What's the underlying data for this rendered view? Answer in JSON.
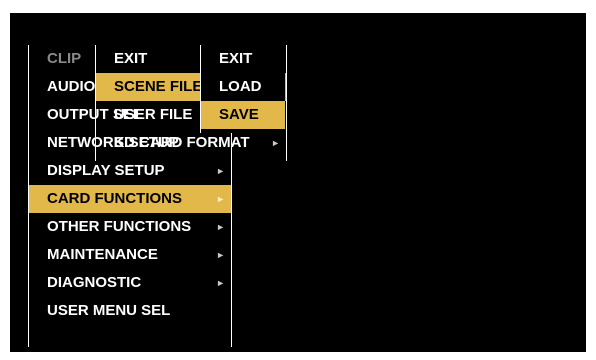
{
  "colors": {
    "background": "#000000",
    "text": "#ffffff",
    "disabled_text": "#8a8a8a",
    "selection": "#e2b84a",
    "selected_text": "#000000"
  },
  "main_menu": {
    "items": [
      {
        "label": "CLIP",
        "disabled": true
      },
      {
        "label": "AUDIO SETUP"
      },
      {
        "label": "OUTPUT SEL"
      },
      {
        "label": "NETWORK SETUP"
      },
      {
        "label": "DISPLAY SETUP",
        "submenu_icon": "right-arrow-icon"
      },
      {
        "label": "CARD FUNCTIONS",
        "submenu_icon": "right-arrow-icon",
        "selected": true
      },
      {
        "label": "OTHER FUNCTIONS",
        "submenu_icon": "right-arrow-icon"
      },
      {
        "label": "MAINTENANCE",
        "submenu_icon": "right-arrow-icon"
      },
      {
        "label": "DIAGNOSTIC",
        "submenu_icon": "right-arrow-icon"
      },
      {
        "label": "USER MENU SEL"
      }
    ]
  },
  "card_functions_menu": {
    "items": [
      {
        "label": "EXIT"
      },
      {
        "label": "SCENE FILE",
        "selected": true
      },
      {
        "label": "USER FILE"
      },
      {
        "label": "SD CARD FORMAT",
        "submenu_icon": "right-arrow-icon"
      }
    ]
  },
  "scene_file_menu": {
    "items": [
      {
        "label": "EXIT"
      },
      {
        "label": "LOAD"
      },
      {
        "label": "SAVE",
        "selected": true
      }
    ]
  },
  "arrow_glyph": "►"
}
